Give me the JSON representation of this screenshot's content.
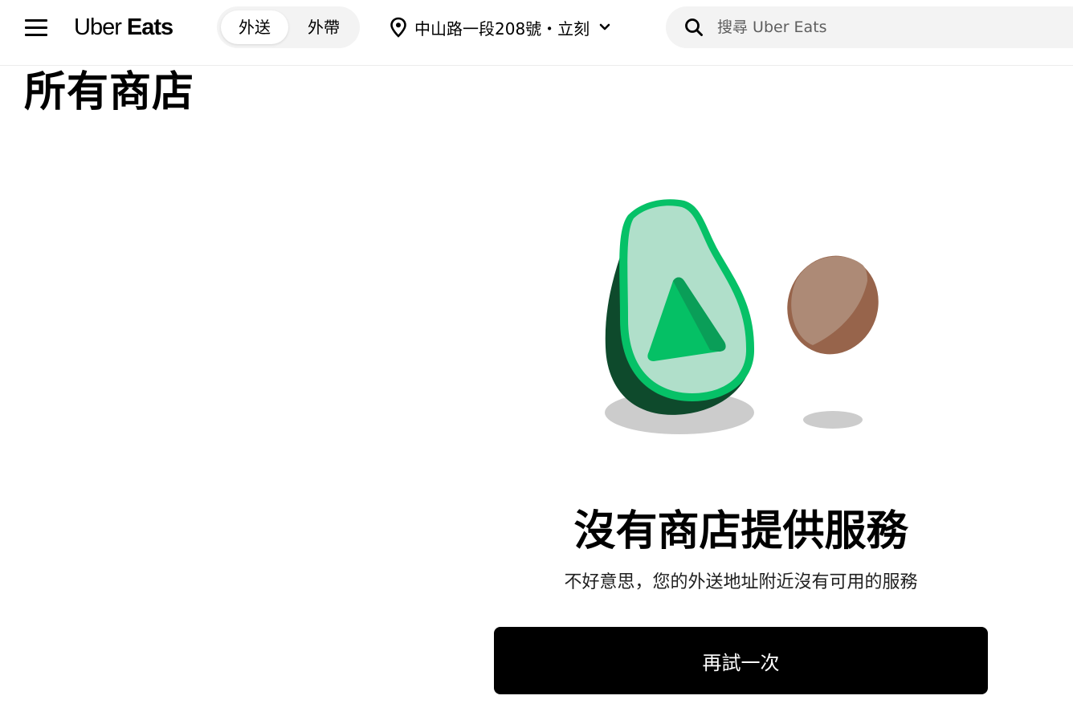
{
  "header": {
    "logo": {
      "part1": "Uber",
      "part2": "Eats"
    },
    "mode_toggle": {
      "delivery": "外送",
      "pickup": "外帶",
      "selected": "delivery"
    },
    "location": {
      "address": "中山路一段208號・立刻"
    },
    "search": {
      "placeholder": "搜尋 Uber Eats",
      "value": ""
    }
  },
  "page": {
    "title": "所有商店"
  },
  "empty_state": {
    "title": "沒有商店提供服務",
    "subtitle": "不好意思，您的外送地址附近沒有可用的服務",
    "retry_label": "再試一次"
  },
  "colors": {
    "avocado_outline": "#06c167",
    "avocado_flesh": "#b0dfca",
    "avocado_skin": "#0e4a2c",
    "avocado_pit_mark": "#05c065",
    "seed_light": "#ad8a76",
    "seed_dark": "#97644b",
    "shadow": "#cccccc",
    "button_bg": "#000000",
    "search_bg": "#f3f3f3"
  },
  "icons": {
    "menu": "hamburger-menu-icon",
    "location": "map-pin-icon",
    "dropdown": "chevron-down-icon",
    "search": "search-icon"
  }
}
